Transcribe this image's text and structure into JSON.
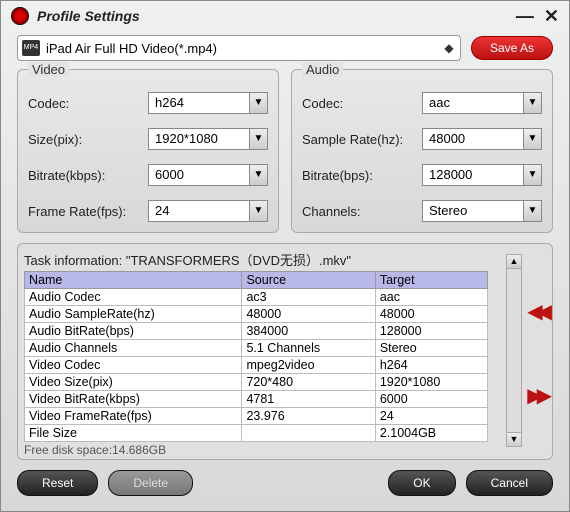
{
  "title": "Profile Settings",
  "profile": {
    "label": "iPad Air Full HD Video(*.mp4)"
  },
  "buttons": {
    "saveas": "Save As",
    "reset": "Reset",
    "delete": "Delete",
    "ok": "OK",
    "cancel": "Cancel"
  },
  "video": {
    "heading": "Video",
    "codec_label": "Codec:",
    "codec": "h264",
    "size_label": "Size(pix):",
    "size": "1920*1080",
    "bitrate_label": "Bitrate(kbps):",
    "bitrate": "6000",
    "fps_label": "Frame Rate(fps):",
    "fps": "24"
  },
  "audio": {
    "heading": "Audio",
    "codec_label": "Codec:",
    "codec": "aac",
    "sample_label": "Sample Rate(hz):",
    "sample": "48000",
    "bitrate_label": "Bitrate(bps):",
    "bitrate": "128000",
    "channels_label": "Channels:",
    "channels": "Stereo"
  },
  "task": {
    "title": "Task information: \"TRANSFORMERS（DVD无损）.mkv\"",
    "headers": {
      "name": "Name",
      "source": "Source",
      "target": "Target"
    },
    "rows": [
      {
        "n": "Audio Codec",
        "s": "ac3",
        "t": "aac"
      },
      {
        "n": "Audio SampleRate(hz)",
        "s": "48000",
        "t": "48000"
      },
      {
        "n": "Audio BitRate(bps)",
        "s": "384000",
        "t": "128000"
      },
      {
        "n": "Audio Channels",
        "s": "5.1 Channels",
        "t": "Stereo"
      },
      {
        "n": "Video Codec",
        "s": "mpeg2video",
        "t": "h264"
      },
      {
        "n": "Video Size(pix)",
        "s": "720*480",
        "t": "1920*1080"
      },
      {
        "n": "Video BitRate(kbps)",
        "s": "4781",
        "t": "6000"
      },
      {
        "n": "Video FrameRate(fps)",
        "s": "23.976",
        "t": "24"
      },
      {
        "n": "File Size",
        "s": "",
        "t": "2.1004GB"
      }
    ],
    "freedisk": "Free disk space:14.686GB"
  }
}
